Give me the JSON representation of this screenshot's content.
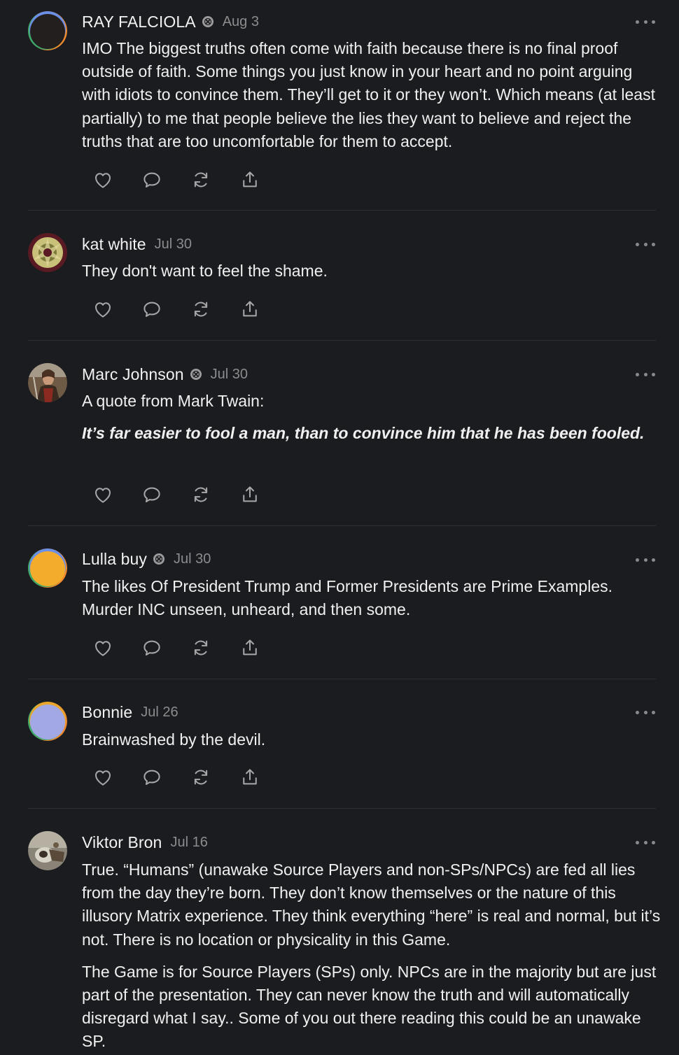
{
  "comments": [
    {
      "author": "RAY FALCIOLA",
      "date": "Aug 3",
      "has_badge": true,
      "paragraphs": [
        "IMO The biggest truths often come with faith because there is no final proof outside of faith. Some things you just know in your heart and no point arguing with idiots to convince them. They’ll get to it or they won’t. Which means (at least partially) to me that people believe the lies they want to believe and reject the truths that are too uncomfortable for them to accept."
      ]
    },
    {
      "author": "kat white",
      "date": "Jul 30",
      "has_badge": false,
      "paragraphs": [
        "They don't want to feel the shame."
      ]
    },
    {
      "author": "Marc Johnson",
      "date": "Jul 30",
      "has_badge": true,
      "paragraphs": [
        "A quote from Mark Twain:"
      ],
      "quote": "It’s far easier to fool a man, than to convince him that he has been fooled."
    },
    {
      "author": "Lulla buy",
      "date": "Jul 30",
      "has_badge": true,
      "paragraphs": [
        "The likes Of President Trump and Former Presidents are Prime Examples. Murder INC unseen, unheard, and then some."
      ]
    },
    {
      "author": "Bonnie",
      "date": "Jul 26",
      "has_badge": false,
      "paragraphs": [
        "Brainwashed by the devil."
      ]
    },
    {
      "author": "Viktor Bron",
      "date": "Jul 16",
      "has_badge": false,
      "paragraphs": [
        "True. “Humans” (unawake Source Players and non-SPs/NPCs) are fed all lies from the day they’re born. They don’t know themselves or the nature of this illusory Matrix experience. They think everything “here” is real and normal, but it’s not. There is no location or physicality in this Game.",
        "The Game is for Source Players (SPs) only. NPCs are in the majority but are just part of the presentation. They can never know the truth and will automatically disregard what I say.. Some of you out there reading this could be an unawake SP."
      ]
    }
  ],
  "icons": {
    "like": "heart-icon",
    "reply": "comment-bubble-icon",
    "restack": "restack-icon",
    "share": "share-icon",
    "more": "more-dots-icon",
    "badge": "subscriber-badge-icon"
  },
  "colors": {
    "background": "#1b1c1f",
    "text": "#f2f2f2",
    "muted": "#8c8c8f",
    "divider": "#2f3034"
  }
}
